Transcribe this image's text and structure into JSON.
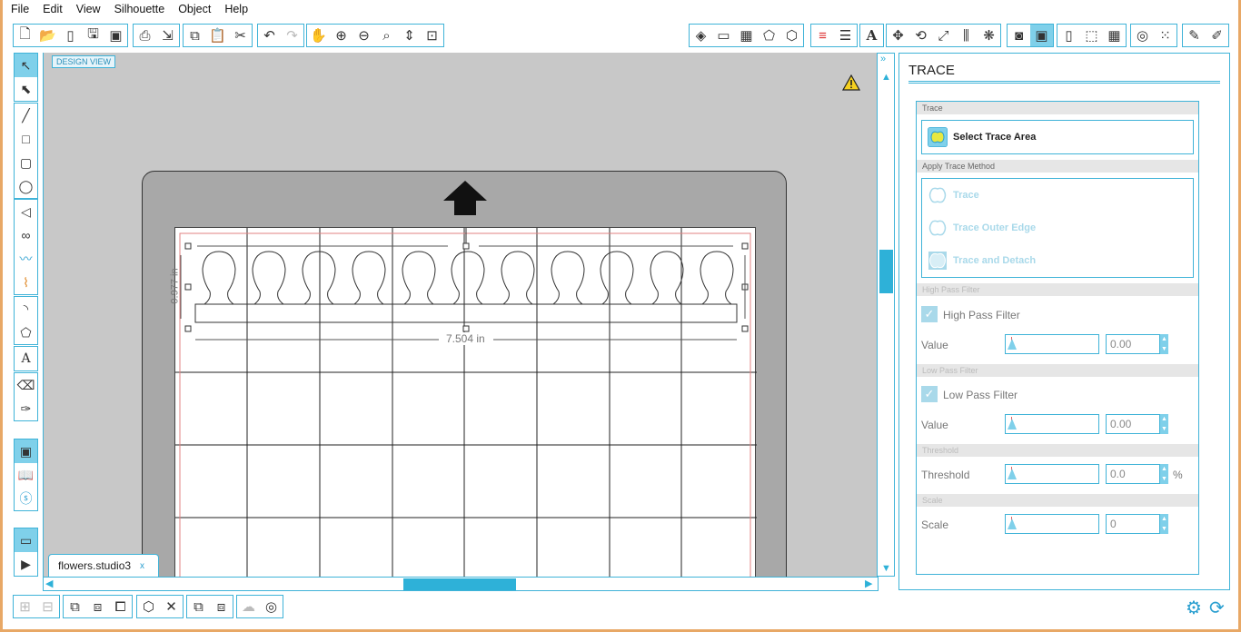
{
  "menu": [
    "File",
    "Edit",
    "View",
    "Silhouette",
    "Object",
    "Help"
  ],
  "canvas": {
    "design_view": "DESIGN VIEW",
    "width_label": "7.504 in",
    "height_label": "0.977 in"
  },
  "doc_tab": {
    "name": "flowers.studio3",
    "close": "x"
  },
  "panel": {
    "title": "TRACE",
    "section_trace": "Trace",
    "select_area": "Select Trace Area",
    "section_method": "Apply Trace Method",
    "trace": "Trace",
    "trace_outer": "Trace Outer Edge",
    "trace_detach": "Trace and Detach",
    "section_high": "High Pass Filter",
    "high_checkbox": "High Pass Filter",
    "high_value_label": "Value",
    "high_value": "0.00",
    "section_low": "Low Pass Filter",
    "low_checkbox": "Low Pass Filter",
    "low_value_label": "Value",
    "low_value": "0.00",
    "section_threshold": "Threshold",
    "threshold_label": "Threshold",
    "threshold_value": "0.0",
    "threshold_unit": "%",
    "section_scale": "Scale",
    "scale_label": "Scale",
    "scale_value": "0"
  },
  "colors": {
    "accent": "#3fb3d8",
    "thumb": "#2eb1d8",
    "active": "#7fd0ea"
  }
}
